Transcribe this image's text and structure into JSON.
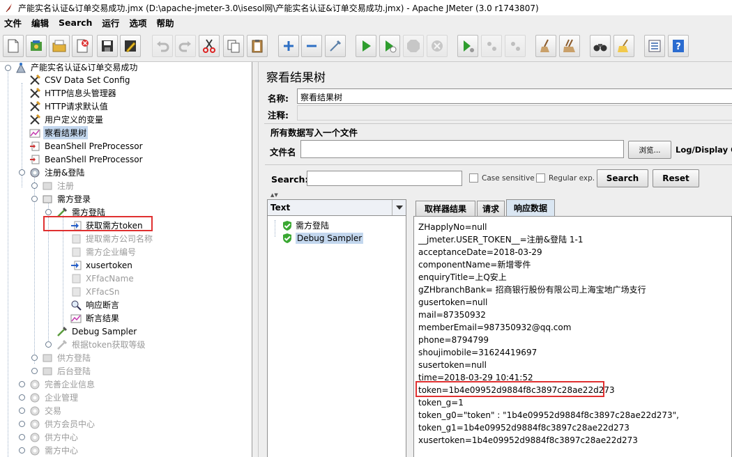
{
  "window": {
    "title": "产能实名认证&订单交易成功.jmx (D:\\apache-jmeter-3.0\\isesol网\\产能实名认证&订单交易成功.jmx) - Apache JMeter (3.0 r1743807)"
  },
  "menubar": {
    "items": [
      "文件",
      "编辑",
      "Search",
      "运行",
      "选项",
      "帮助"
    ]
  },
  "tree": {
    "nodes": [
      {
        "label": "产能实名认证&订单交易成功"
      },
      {
        "label": "CSV Data Set Config"
      },
      {
        "label": "HTTP信息头管理器"
      },
      {
        "label": "HTTP请求默认值"
      },
      {
        "label": "用户定义的变量"
      },
      {
        "label": "察看结果树"
      },
      {
        "label": "BeanShell PreProcessor"
      },
      {
        "label": "BeanShell PreProcessor"
      },
      {
        "label": "注册&登陆"
      },
      {
        "label": "注册"
      },
      {
        "label": "需方登录"
      },
      {
        "label": "需方登陆"
      },
      {
        "label": "获取需方token"
      },
      {
        "label": "提取需方公司名称"
      },
      {
        "label": "需方企业编号"
      },
      {
        "label": "xusertoken"
      },
      {
        "label": "XFfacName"
      },
      {
        "label": "XFfacSn"
      },
      {
        "label": "响应断言"
      },
      {
        "label": "断言结果"
      },
      {
        "label": "Debug Sampler"
      },
      {
        "label": "根据token获取等级"
      },
      {
        "label": "供方登陆"
      },
      {
        "label": "后台登陆"
      },
      {
        "label": "完善企业信息"
      },
      {
        "label": "企业管理"
      },
      {
        "label": "交易"
      },
      {
        "label": "供方会员中心"
      },
      {
        "label": "供方中心"
      },
      {
        "label": "需方中心"
      }
    ]
  },
  "panel": {
    "title": "察看结果树",
    "name_label": "名称:",
    "name_value": "察看结果树",
    "comment_label": "注释:",
    "comment_value": "",
    "file_group_title": "所有数据写入一个文件",
    "filename_label": "文件名",
    "filename_value": "",
    "browse_label": "浏览...",
    "log_display_label": "Log/Display Or",
    "search_label": "Search:",
    "search_value": "",
    "case_sensitive_label": "Case sensitive",
    "regular_exp_label": "Regular exp.",
    "search_button": "Search",
    "reset_button": "Reset"
  },
  "results": {
    "renderer": "Text",
    "samples": [
      {
        "label": "需方登陆",
        "status": "success"
      },
      {
        "label": "Debug Sampler",
        "status": "success"
      }
    ],
    "tabs": [
      "取样器结果",
      "请求",
      "响应数据"
    ],
    "active_tab": "响应数据",
    "response_lines": [
      "ZHapplyNo=null",
      "__jmeter.USER_TOKEN__=注册&登陆 1-1",
      "acceptanceDate=2018-03-29",
      "componentName=新增零件",
      "enquiryTitle=上Q安上",
      "gZHbranchBank= 招商银行股份有限公司上海宝地广场支行",
      "gusertoken=null",
      "mail=87350932",
      "memberEmail=987350932@qq.com",
      "phone=8794799",
      "shoujimobile=31624419697",
      "susertoken=null",
      "time=2018-03-29 10:41:52",
      "token=1b4e09952d9884f8c3897c28ae22d273",
      "token_g=1",
      "token_g0=\"token\" : \"1b4e09952d9884f8c3897c28ae22d273\",",
      "token_g1=1b4e09952d9884f8c3897c28ae22d273",
      "xusertoken=1b4e09952d9884f8c3897c28ae22d273"
    ]
  },
  "colors": {
    "selection": "#c3d7ee",
    "highlight_box": "#e03030",
    "success_shield": "#3aa832"
  }
}
